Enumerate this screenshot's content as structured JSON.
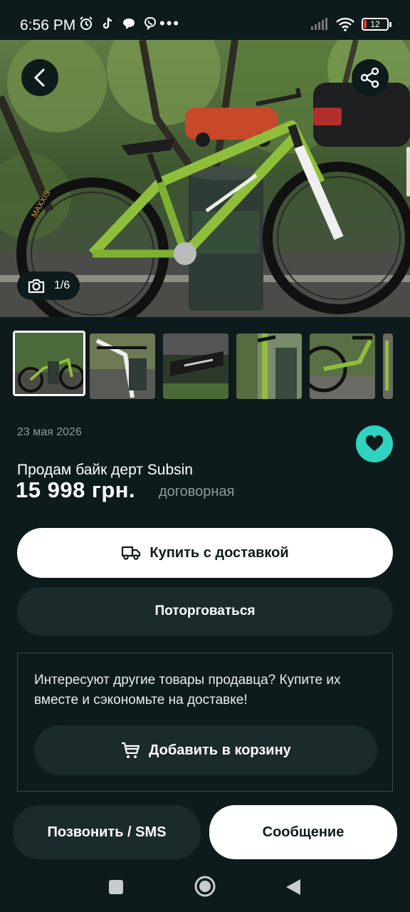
{
  "status_bar": {
    "time": "6:56 PM",
    "battery": "12",
    "left_icons": [
      "alarm-icon",
      "tiktok-icon",
      "chat-icon",
      "viber-icon",
      "more-icon"
    ],
    "right_icons": [
      "signal-icon",
      "wifi-icon",
      "battery-icon"
    ]
  },
  "gallery": {
    "counter": "1/6",
    "thumbnail_count": 6,
    "active_index": 0
  },
  "listing": {
    "date": "23 мая 2026",
    "title": "Продам байк дерт Subsin",
    "price": "15 998 грн.",
    "negotiable": "договорная"
  },
  "actions": {
    "buy_label": "Купить с доставкой",
    "bargain_label": "Поторговаться",
    "promo_text": "Интересуют другие товары продавца? Купите их вместе и сэкономьте на доставке!",
    "cart_label": "Добавить в корзину",
    "call_label": "Позвонить / SMS",
    "message_label": "Сообщение"
  },
  "colors": {
    "background": "#0e1b1c",
    "accent": "#2fd3c0",
    "button_dark": "#1b2a2b",
    "button_light": "#ffffff",
    "muted_text": "#8e9a9a"
  }
}
